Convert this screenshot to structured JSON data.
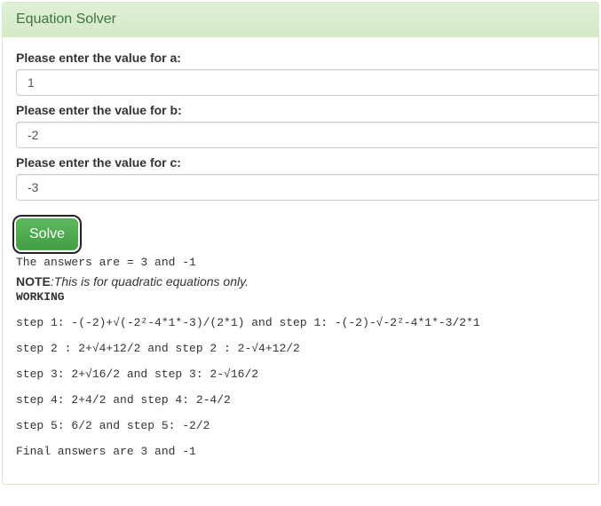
{
  "title": "Equation Solver",
  "fields": {
    "a": {
      "label": "Please enter the value for a:",
      "value": "1"
    },
    "b": {
      "label": "Please enter the value for b:",
      "value": "-2"
    },
    "c": {
      "label": "Please enter the value for c:",
      "value": "-3"
    }
  },
  "solve_label": "Solve",
  "answers_text": "The answers are = 3 and -1",
  "note_label": "NOTE",
  "note_text": ":This is for quadratic equations only.",
  "working_label": "WORKING",
  "steps": [
    "step 1: -(-2)+√(-2²-4*1*-3)/(2*1) and step 1: -(-2)-√-2²-4*1*-3/2*1",
    "step 2 : 2+√4+12/2 and step 2 : 2-√4+12/2",
    "step 3: 2+√16/2 and step 3: 2-√16/2",
    "step 4: 2+4/2 and step 4: 2-4/2",
    "step 5: 6/2 and step 5: -2/2",
    "Final answers are 3 and -1"
  ]
}
